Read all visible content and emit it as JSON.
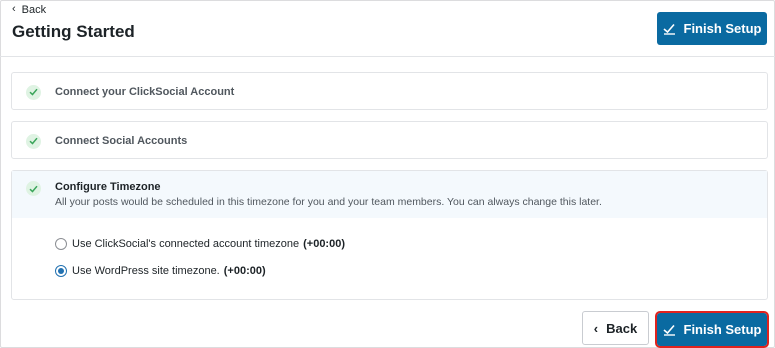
{
  "header": {
    "back_label": "Back",
    "title": "Getting Started",
    "finish_label": "Finish Setup"
  },
  "steps": [
    {
      "title": "Connect your ClickSocial Account",
      "completed": true
    },
    {
      "title": "Connect Social Accounts",
      "completed": true
    },
    {
      "title": "Configure Timezone",
      "description": "All your posts would be scheduled in this timezone for you and your team members. You can always change this later.",
      "completed": true
    }
  ],
  "timezone_options": [
    {
      "label": "Use ClickSocial's connected account timezone",
      "offset": "(+00:00)",
      "selected": false
    },
    {
      "label": "Use WordPress site timezone.",
      "offset": "(+00:00)",
      "selected": true
    }
  ],
  "footer": {
    "back_label": "Back",
    "finish_label": "Finish Setup"
  },
  "colors": {
    "primary": "#0a6aa1",
    "check_bg": "#dff3e3",
    "check_mark": "#3aa55a",
    "highlight_border": "#e0231e"
  }
}
